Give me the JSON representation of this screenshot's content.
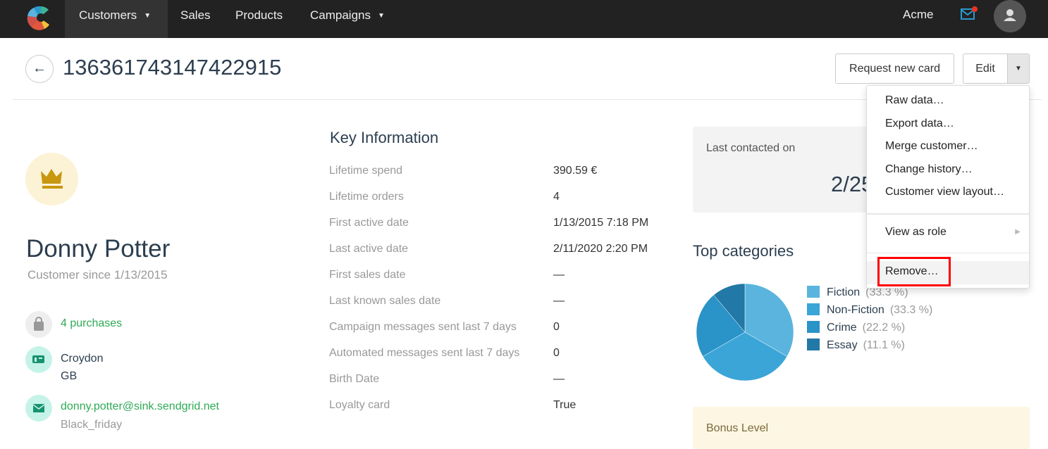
{
  "nav": {
    "items": [
      {
        "label": "Customers",
        "caret": true
      },
      {
        "label": "Sales"
      },
      {
        "label": "Products"
      },
      {
        "label": "Campaigns",
        "caret": true
      }
    ],
    "account": "Acme"
  },
  "header": {
    "title": "1363617431474229​15",
    "request_card": "Request new card",
    "edit": "Edit"
  },
  "profile": {
    "name": "Donny Potter",
    "since": "Customer since 1/13/2015",
    "purchases": "4 purchases",
    "city": "Croydon",
    "country": "GB",
    "email": "donny.potter@sink.sendgrid.net",
    "segment": "Black_friday"
  },
  "key_info": {
    "title": "Key Information",
    "rows": [
      {
        "label": "Lifetime spend",
        "value": "390.59 €"
      },
      {
        "label": "Lifetime orders",
        "value": "4"
      },
      {
        "label": "First active date",
        "value": "1/13/2015 7:18 PM"
      },
      {
        "label": "Last active date",
        "value": "2/11/2020 2:20 PM"
      },
      {
        "label": "First sales date",
        "value": "—"
      },
      {
        "label": "Last known sales date",
        "value": "—"
      },
      {
        "label": "Campaign messages sent last 7 days",
        "value": "0"
      },
      {
        "label": "Automated messages sent last 7 days",
        "value": "0"
      },
      {
        "label": "Birth Date",
        "value": "—"
      },
      {
        "label": "Loyalty card",
        "value": "True"
      }
    ]
  },
  "last_contacted": {
    "label": "Last contacted on",
    "value": "2/25"
  },
  "bonus": {
    "label": "Bonus Level"
  },
  "menu": {
    "items": [
      "Raw data…",
      "Export data…",
      "Merge customer…",
      "Change history…",
      "Customer view layout…"
    ],
    "view_as_role": "View as role",
    "remove": "Remove…"
  },
  "chart_data": {
    "type": "pie",
    "title": "Top categories",
    "legend": "right",
    "series": [
      {
        "name": "Fiction",
        "value": 33.3,
        "label": "(33.3 %)",
        "color": "#5ab4de"
      },
      {
        "name": "Non-Fiction",
        "value": 33.3,
        "label": "(33.3 %)",
        "color": "#3ba5d8"
      },
      {
        "name": "Crime",
        "value": 22.2,
        "label": "(22.2 %)",
        "color": "#2a93c8"
      },
      {
        "name": "Essay",
        "value": 11.1,
        "label": "(11.1 %)",
        "color": "#2278a6"
      }
    ]
  }
}
